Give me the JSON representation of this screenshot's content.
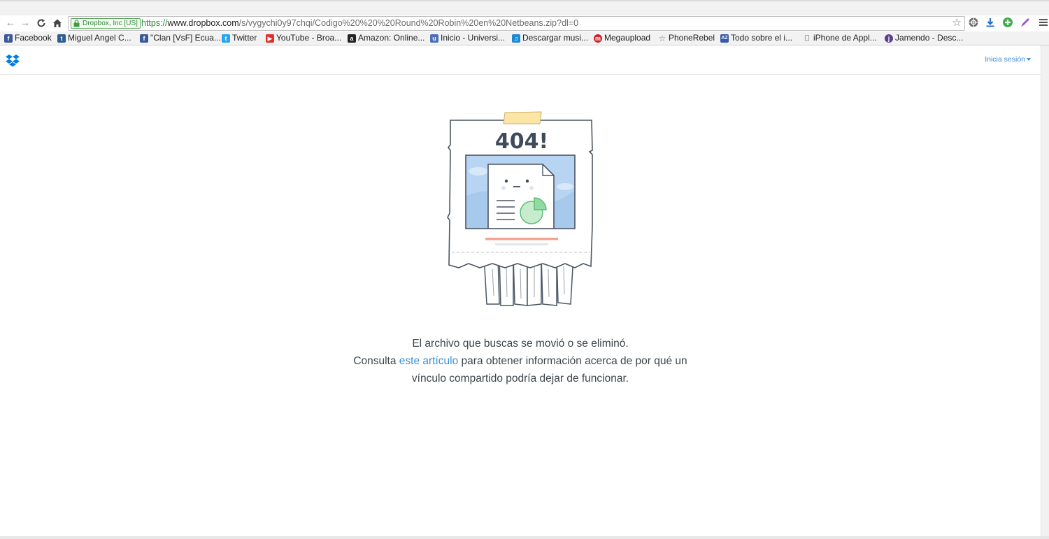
{
  "browser": {
    "ev_badge": "Dropbox, Inc [US]",
    "url_scheme": "https://",
    "url_host": "www.dropbox.com",
    "url_path": "/s/vygychi0y97chqi/Codigo%20%20%20Round%20Robin%20en%20Netbeans.zip?dl=0",
    "bookmarks": [
      {
        "label": "Facebook",
        "icon": "facebook-icon",
        "color": "#3b5998"
      },
      {
        "label": "Miguel Angel C...",
        "icon": "tuenti-icon",
        "color": "#2f5d8c"
      },
      {
        "label": "\"Clan [VsF] Ecua...",
        "icon": "facebook-icon",
        "color": "#3b5998"
      },
      {
        "label": "Twitter",
        "icon": "twitter-icon",
        "color": "#2aa3ef"
      },
      {
        "label": "YouTube - Broa...",
        "icon": "youtube-icon",
        "color": "#e52d27"
      },
      {
        "label": "Amazon: Online...",
        "icon": "amazon-icon",
        "color": "#222222"
      },
      {
        "label": "Inicio - Universi...",
        "icon": "university-icon",
        "color": "#4a6fb5"
      },
      {
        "label": "Descargar musi...",
        "icon": "download-music-icon",
        "color": "#1e88d2"
      },
      {
        "label": "Megaupload",
        "icon": "megaupload-icon",
        "color": "#d0202a"
      },
      {
        "label": "PhoneRebel",
        "icon": "star-icon",
        "color": "#888888"
      },
      {
        "label": "Todo sobre el i...",
        "icon": "az-icon",
        "color": "#3a5aa8"
      },
      {
        "label": "iPhone de Appl...",
        "icon": "apple-icon",
        "color": "#333333"
      },
      {
        "label": "Jamendo - Desc...",
        "icon": "jamendo-icon",
        "color": "#5b3f8c"
      }
    ]
  },
  "header": {
    "signin_label": "Inicia sesión"
  },
  "illustration": {
    "error_code": "404!"
  },
  "message": {
    "line1": "El archivo que buscas se movió o se eliminó.",
    "line2_before": "Consulta ",
    "line2_link": "este artículo",
    "line2_after": " para obtener información acerca de por qué un",
    "line3": "vínculo compartido podría dejar de funcionar."
  },
  "colors": {
    "link": "#3d8fd6",
    "ev_green": "#2f8a35",
    "dropbox_blue": "#007ee5"
  }
}
